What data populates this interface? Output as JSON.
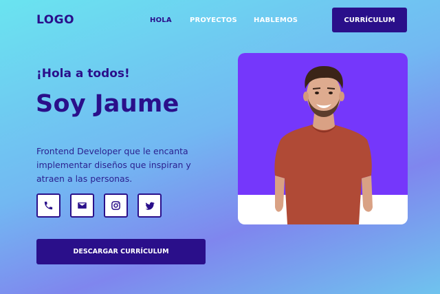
{
  "nav": {
    "logo": "LOGO",
    "links": [
      "HOLA",
      "PROYECTOS",
      "HABLEMOS"
    ],
    "cta": "CURRÍCULUM"
  },
  "hero": {
    "greeting": "¡Hola a todos!",
    "title": "Soy Jaume",
    "description": "Frontend Developer que le encanta implementar diseños que inspiran y atraen a las personas.",
    "download_button": "DESCARGAR CURRÍCULUM"
  },
  "socials": [
    "phone-icon",
    "mail-icon",
    "instagram-icon",
    "twitter-icon"
  ],
  "colors": {
    "primary": "#2a0f8a",
    "photo_background": "#7537fb",
    "shirt": "#b04a36"
  }
}
